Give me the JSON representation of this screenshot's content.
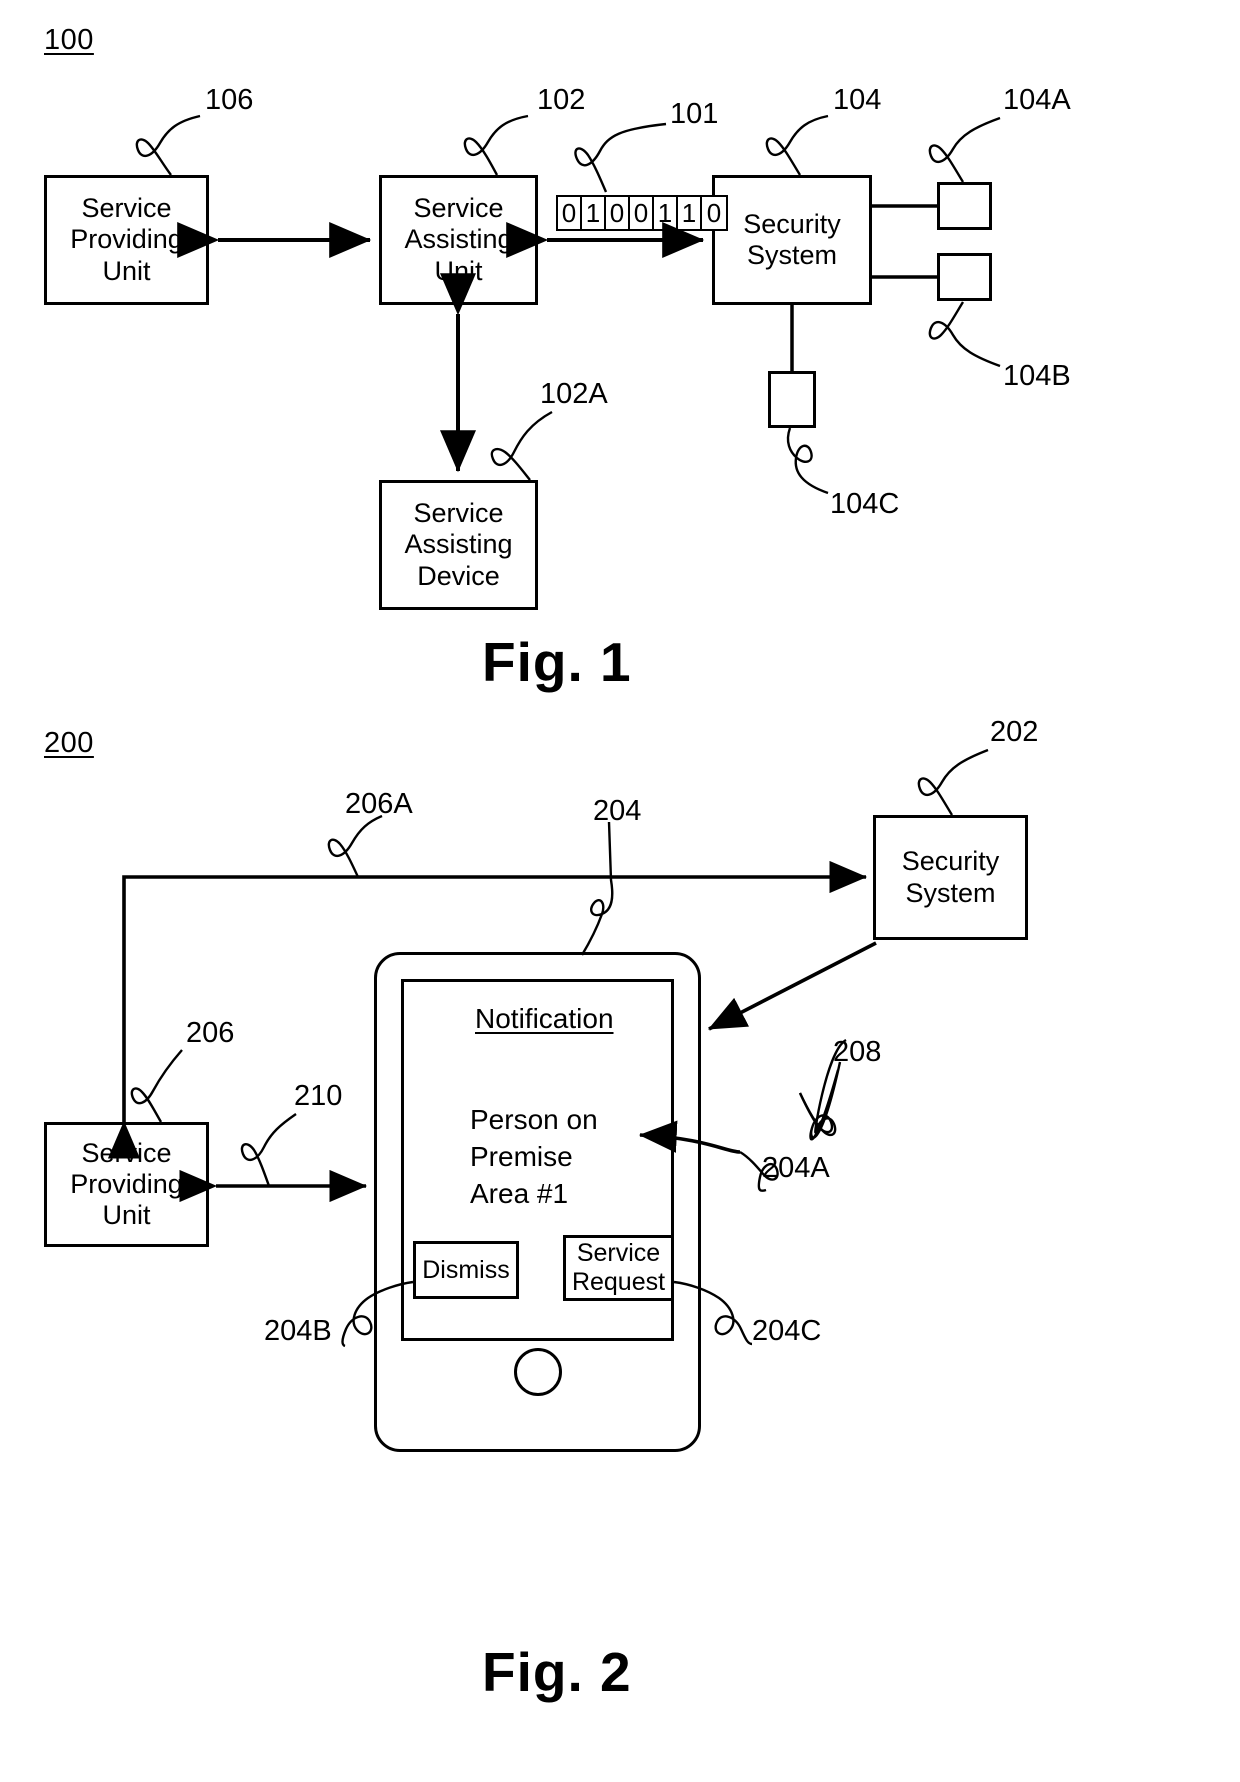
{
  "figures": [
    {
      "id": "fig1",
      "figure_number": "100",
      "caption": "Fig. 1",
      "blocks": [
        {
          "key": "service_providing_unit",
          "lines": [
            "Service",
            "Providing",
            "Unit"
          ],
          "ref": "106"
        },
        {
          "key": "service_assisting_unit",
          "lines": [
            "Service",
            "Assisting",
            "Unit"
          ],
          "ref": "102"
        },
        {
          "key": "security_system",
          "lines": [
            "Security",
            "System"
          ],
          "ref": "104"
        },
        {
          "key": "service_assisting_device",
          "lines": [
            "Service",
            "Assisting",
            "Device"
          ],
          "ref": "102A"
        }
      ],
      "packet": {
        "ref": "101",
        "bits": [
          "0",
          "1",
          "0",
          "0",
          "1",
          "1",
          "0"
        ]
      },
      "sensors": [
        {
          "key": "sensor_a",
          "ref": "104A"
        },
        {
          "key": "sensor_b",
          "ref": "104B"
        },
        {
          "key": "sensor_c",
          "ref": "104C"
        }
      ]
    },
    {
      "id": "fig2",
      "figure_number": "200",
      "caption": "Fig. 2",
      "blocks": [
        {
          "key": "security_system",
          "lines": [
            "Security",
            "System"
          ],
          "ref": "202"
        },
        {
          "key": "service_providing_unit",
          "lines": [
            "Service",
            "Providing",
            "Unit"
          ],
          "ref": "206"
        }
      ],
      "connector_refs": [
        {
          "key": "link_unit_to_security",
          "ref": "206A"
        },
        {
          "key": "link_unit_to_phone",
          "ref": "210"
        },
        {
          "key": "link_security_to_phone",
          "ref": "208"
        },
        {
          "key": "phone_device",
          "ref": "204"
        },
        {
          "key": "notification_message",
          "ref": "204A"
        },
        {
          "key": "dismiss_button_ref",
          "ref": "204B"
        },
        {
          "key": "service_request_button_ref",
          "ref": "204C"
        }
      ],
      "phone": {
        "notification_title": "Notification",
        "notification_lines": [
          "Person on",
          "Premise",
          "Area #1"
        ],
        "buttons": [
          {
            "key": "dismiss",
            "lines": [
              "Dismiss"
            ]
          },
          {
            "key": "service_request",
            "lines": [
              "Service",
              "Request"
            ]
          }
        ]
      }
    }
  ]
}
